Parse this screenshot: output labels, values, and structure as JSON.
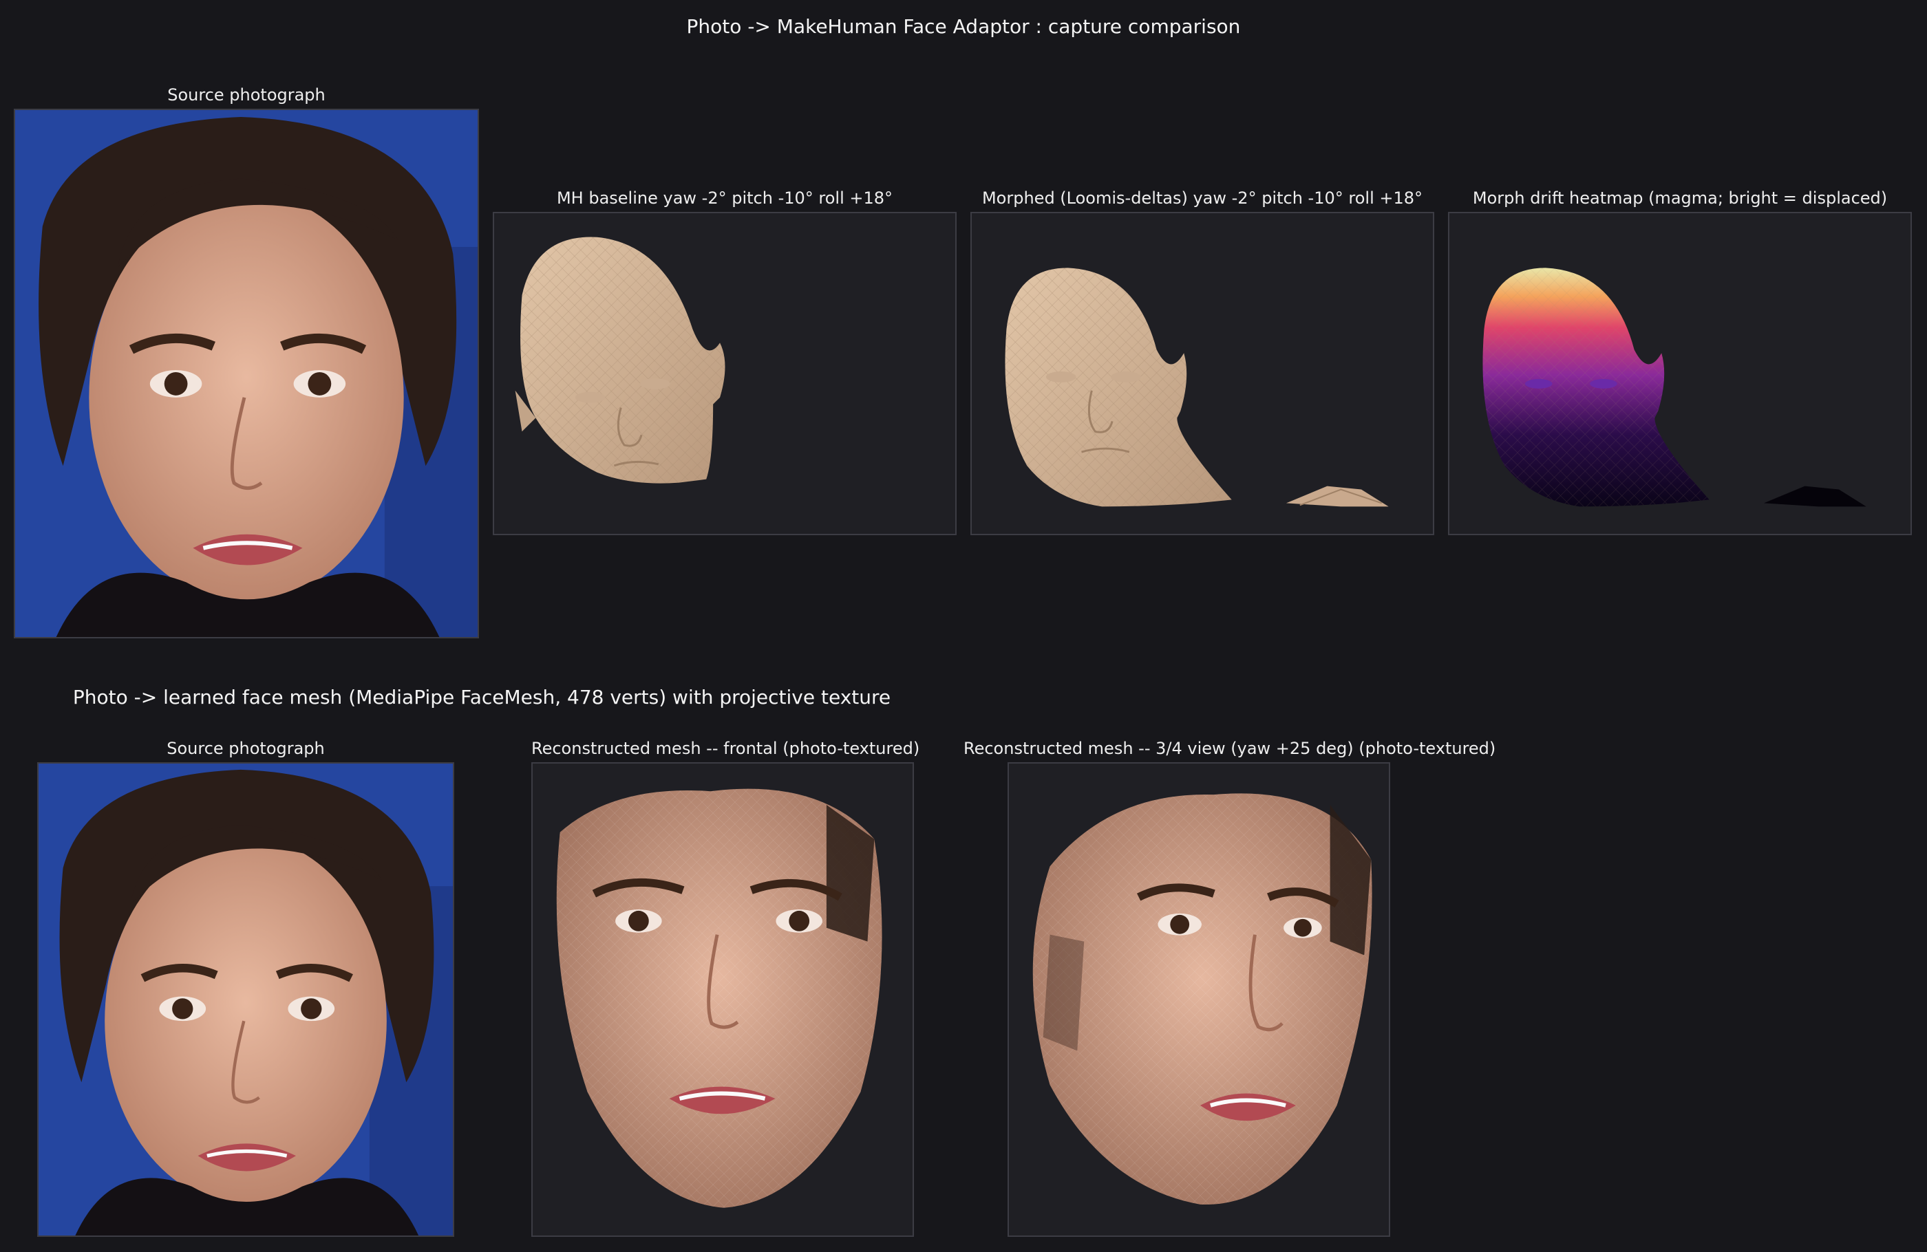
{
  "section1": {
    "title": "Photo -> MakeHuman Face Adaptor : capture comparison",
    "source_caption": "Source photograph",
    "baseline_caption": "MH baseline  yaw -2°  pitch -10°  roll +18°",
    "morphed_caption": "Morphed (Loomis-deltas)  yaw -2°  pitch -10°  roll +18°",
    "heatmap_caption": "Morph drift heatmap  (magma; bright = displaced)"
  },
  "section2": {
    "title": "Photo -> learned face mesh (MediaPipe FaceMesh, 478 verts) with projective texture",
    "source_caption": "Source photograph",
    "frontal_caption": "Reconstructed mesh -- frontal (photo-textured)",
    "three_quarter_caption": "Reconstructed mesh -- 3/4 view (yaw +25 deg) (photo-textured)"
  },
  "colors": {
    "background": "#17171b",
    "panel": "#1f1f24",
    "mesh_skin": "#d2b59a",
    "photo_backdrop": "#2546a0"
  }
}
